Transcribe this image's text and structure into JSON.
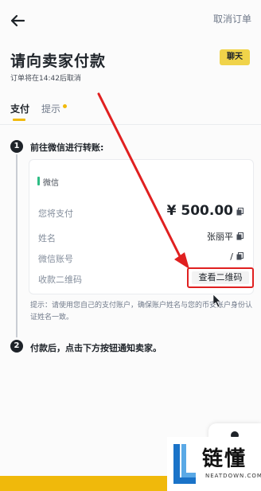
{
  "header": {
    "cancel_order": "取消订单",
    "title": "请向卖家付款",
    "subtitle": "订单将在14:42后取消",
    "chat": "聊天"
  },
  "tabs": [
    {
      "label": "支付",
      "active": true
    },
    {
      "label": "提示",
      "active": false
    }
  ],
  "step1": {
    "num": "1",
    "label": "前往微信进行转账:"
  },
  "payment": {
    "method": "微信",
    "amount_label": "您将支付",
    "amount": "¥ 500.00",
    "name_label": "姓名",
    "name_value": "张丽平",
    "account_label": "微信账号",
    "account_value": "/",
    "qr_label": "收款二维码",
    "qr_button": "查看二维码"
  },
  "note": "提示：请使用您自己的支付账户，确保账户姓名与您的币安账户身份认证姓名一致。",
  "step2": {
    "num": "2",
    "label": "付款后，点击下方按钮通知卖家。"
  },
  "watermark": {
    "text": "链懂",
    "sub": "NEATDOWN.COM"
  },
  "colors": {
    "accent": "#f0b90b",
    "annotation": "#e02020",
    "wechat": "#2ebd85"
  }
}
